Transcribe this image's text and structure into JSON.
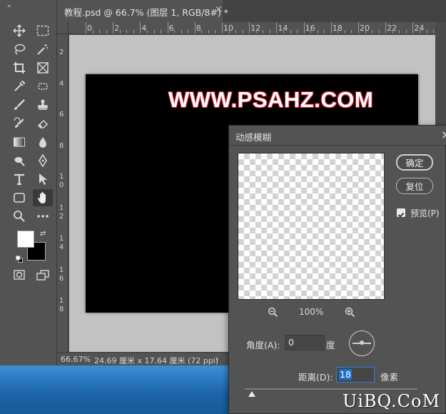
{
  "document_tab": {
    "title": "教程.psd @ 66.7% (图层 1, RGB/8#) *",
    "close": "×"
  },
  "toolbar": {
    "collapse": "«"
  },
  "ruler_top_labels": [
    "0",
    "2",
    "4",
    "6",
    "8",
    "10",
    "12",
    "14",
    "16",
    "18",
    "20",
    "22",
    "24"
  ],
  "ruler_left_labels": [
    "2",
    "4",
    "6",
    "8",
    "1\n0",
    "1\n2",
    "1\n4",
    "1\n6",
    "1\n8"
  ],
  "canvas_text": "WWW.PSAHZ.COM",
  "statusbar": {
    "zoom": "66.67%",
    "info": "24.69 厘米 x 17.64 厘米 (72 ppi)",
    "arrow": "›"
  },
  "dialog": {
    "title": "动感模糊",
    "close": "×",
    "ok_label": "确定",
    "reset_label": "复位",
    "preview_label": "预览(P)",
    "preview_checked": true,
    "zoom_percent": "100%",
    "angle_label": "角度(A):",
    "angle_value": "0",
    "angle_unit": "度",
    "distance_label": "距离(D):",
    "distance_value": "18",
    "distance_unit": "像素"
  },
  "site_watermark": "UiBQ.CoM",
  "colors": {
    "foreground": "#ffffff",
    "background": "#000000",
    "accent": "#1c6fd0",
    "watermark_outline": "#c8192c"
  }
}
